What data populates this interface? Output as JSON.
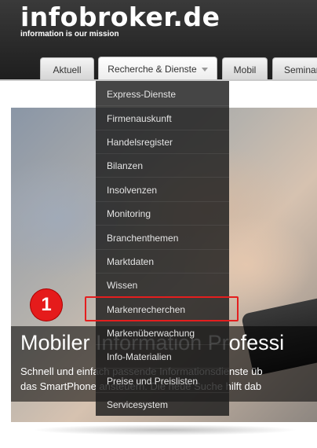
{
  "header": {
    "logo": "infobroker.de",
    "tagline": "information is our mission"
  },
  "tabs": [
    {
      "label": "Aktuell"
    },
    {
      "label": "Recherche & Dienste"
    },
    {
      "label": "Mobil"
    },
    {
      "label": "Seminar"
    }
  ],
  "dropdown": {
    "items": [
      {
        "label": "Express-Dienste"
      },
      {
        "label": "Firmenauskunft"
      },
      {
        "label": "Handelsregister"
      },
      {
        "label": "Bilanzen"
      },
      {
        "label": "Insolvenzen"
      },
      {
        "label": "Monitoring"
      },
      {
        "label": "Branchenthemen"
      },
      {
        "label": "Marktdaten"
      },
      {
        "label": "Wissen"
      },
      {
        "label": "Markenrecherchen"
      },
      {
        "label": "Markenüberwachung"
      },
      {
        "label": "Info-Materialien"
      },
      {
        "label": "Preise und Preislisten"
      },
      {
        "label": "Servicesystem"
      }
    ]
  },
  "hero": {
    "title": "Mobiler Information Professi",
    "text_line1": "Schnell und einfach passende Informationsdienste üb",
    "text_line2": "das SmartPhone  ansteuern. Die neue Suche hilft dab"
  },
  "annotation": {
    "badge_number": "1",
    "accent_color": "#e41e1e"
  }
}
